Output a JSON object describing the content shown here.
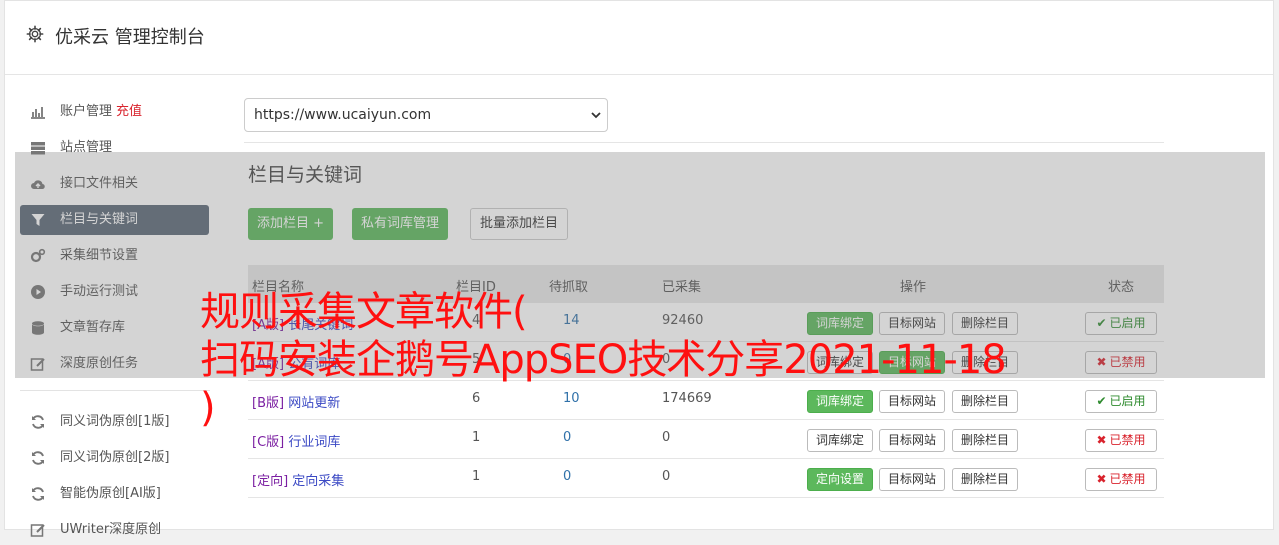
{
  "header": {
    "title": "优采云 管理控制台"
  },
  "sidebar": {
    "items": [
      {
        "label": "账户管理",
        "extra": "充值",
        "icon": "bar-chart-icon"
      },
      {
        "label": "站点管理",
        "icon": "server-icon"
      },
      {
        "label": "接口文件相关",
        "icon": "cloud-upload-icon"
      },
      {
        "label": "栏目与关键词",
        "icon": "filter-icon",
        "active": true
      },
      {
        "label": "采集细节设置",
        "icon": "gears-icon"
      },
      {
        "label": "手动运行测试",
        "icon": "play-circle-icon"
      },
      {
        "label": "文章暂存库",
        "icon": "database-icon"
      },
      {
        "label": "深度原创任务",
        "icon": "edit-icon"
      }
    ],
    "items2": [
      {
        "label": "同义词伪原创[1版]",
        "icon": "refresh-icon"
      },
      {
        "label": "同义词伪原创[2版]",
        "icon": "refresh-icon"
      },
      {
        "label": "智能伪原创[AI版]",
        "icon": "refresh-icon"
      },
      {
        "label": "UWriter深度原创",
        "icon": "edit-icon"
      }
    ]
  },
  "main": {
    "site_select": "https://www.ucaiyun.com",
    "section_title": "栏目与关键词",
    "buttons": {
      "add_column": "添加栏目 +",
      "private_lib": "私有词库管理",
      "batch_add": "批量添加栏目"
    }
  },
  "table": {
    "headers": {
      "name": "栏目名称",
      "id": "栏目ID",
      "pending": "待抓取",
      "done": "已采集",
      "ops": "操作",
      "status": "状态"
    },
    "rows": [
      {
        "tag": "[A版]",
        "name": "长尾关键词",
        "id": "4",
        "pending": "14",
        "done": "92460",
        "op1": "词库绑定",
        "op2": "目标网站",
        "op3": "删除栏目",
        "status": "已启用"
      },
      {
        "tag": "[A版]",
        "name": "公有词库",
        "id": "5",
        "pending": "0",
        "done": "0",
        "op1": "词库绑定",
        "op2": "目标网站",
        "op3": "删除栏目",
        "status": "已禁用"
      },
      {
        "tag": "[B版]",
        "name": "网站更新",
        "id": "6",
        "pending": "10",
        "done": "174669",
        "op1": "词库绑定",
        "op2": "目标网站",
        "op3": "删除栏目",
        "status": "已启用"
      },
      {
        "tag": "[C版]",
        "name": "行业词库",
        "id": "1",
        "pending": "0",
        "done": "0",
        "op1": "词库绑定",
        "op2": "目标网站",
        "op3": "删除栏目",
        "status": "已禁用"
      },
      {
        "tag": "[定向]",
        "name": "定向采集",
        "id": "1",
        "pending": "0",
        "done": "0",
        "op1": "定向设置",
        "op2": "目标网站",
        "op3": "删除栏目",
        "status": "已禁用"
      }
    ]
  },
  "overlay_text": {
    "line1": "规则采集文章软件(",
    "line2": "扫码安装企鹅号AppSEO技术分享2021-11-18",
    "line3": ")"
  },
  "colors": {
    "primary_green": "#5cb85c",
    "active_nav": "#5a6776",
    "danger": "#d9232d",
    "overlay_red": "#ff1010"
  }
}
